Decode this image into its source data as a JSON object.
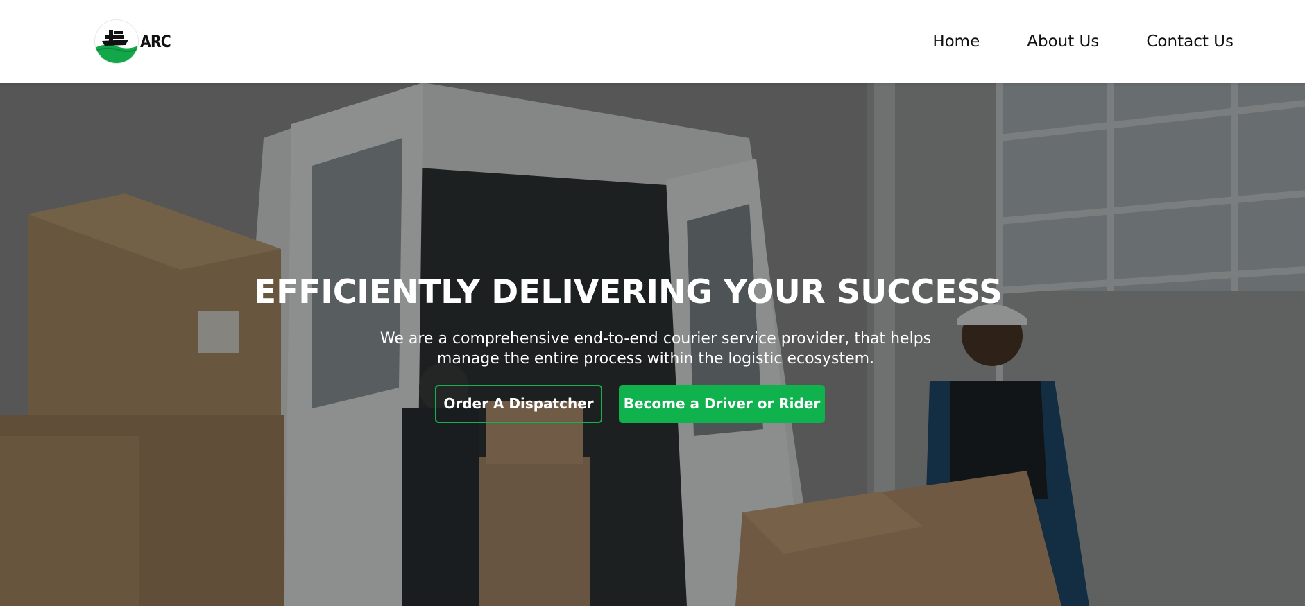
{
  "brand": {
    "name": "ARC",
    "accent_color": "#0fb24d"
  },
  "nav": {
    "items": [
      {
        "label": "Home"
      },
      {
        "label": "About Us"
      },
      {
        "label": "Contact Us"
      }
    ]
  },
  "hero": {
    "title": "EFFICIENTLY DELIVERING YOUR SUCCESS",
    "subtitle": "We are a comprehensive end-to-end courier service provider, that helps manage the entire process within the logistic ecosystem.",
    "buttons": {
      "primary_label": "Order A Dispatcher",
      "secondary_label": "Become a Driver or Rider"
    }
  }
}
